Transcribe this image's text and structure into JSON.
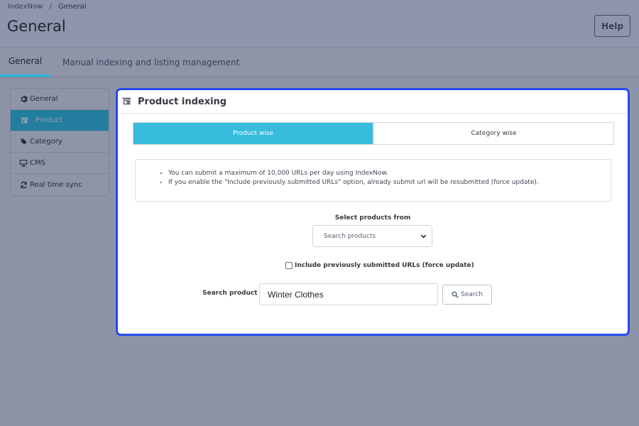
{
  "breadcrumb": {
    "parent": "IndexNow",
    "separator": "/",
    "current": "General"
  },
  "header": {
    "title": "General",
    "help_label": "Help"
  },
  "tabs": [
    {
      "label": "General",
      "active": true
    },
    {
      "label": "Manual indexing and listing management",
      "active": false
    }
  ],
  "sidebar": {
    "items": [
      {
        "label": "General",
        "icon": "gear-icon"
      },
      {
        "label": "Product",
        "icon": "store-icon",
        "active": true
      },
      {
        "label": "Category",
        "icon": "tags-icon"
      },
      {
        "label": "CMS",
        "icon": "monitor-icon"
      },
      {
        "label": "Real time sync",
        "icon": "sync-icon"
      }
    ]
  },
  "panel": {
    "title": "Product indexing",
    "title_icon": "store-icon",
    "segments": [
      {
        "label": "Product wise",
        "active": true
      },
      {
        "label": "Category wise",
        "active": false
      }
    ],
    "info": [
      "You can submit a maximum of 10,000 URLs per day using IndexNow.",
      "If you enable the \"Include previously submitted URLs\" option, already submit url will be resubmitted (force update)."
    ],
    "select_label": "Select products from",
    "select_value": "Search products",
    "checkbox_label": "Include previously submitted URLs (force update)",
    "checkbox_checked": false,
    "search_label": "Search product",
    "search_value": "Winter Clothes",
    "search_button": "Search"
  },
  "colors": {
    "accent": "#25b9d7",
    "focus_border": "#2549f0",
    "overlay": "#8d94a8"
  }
}
